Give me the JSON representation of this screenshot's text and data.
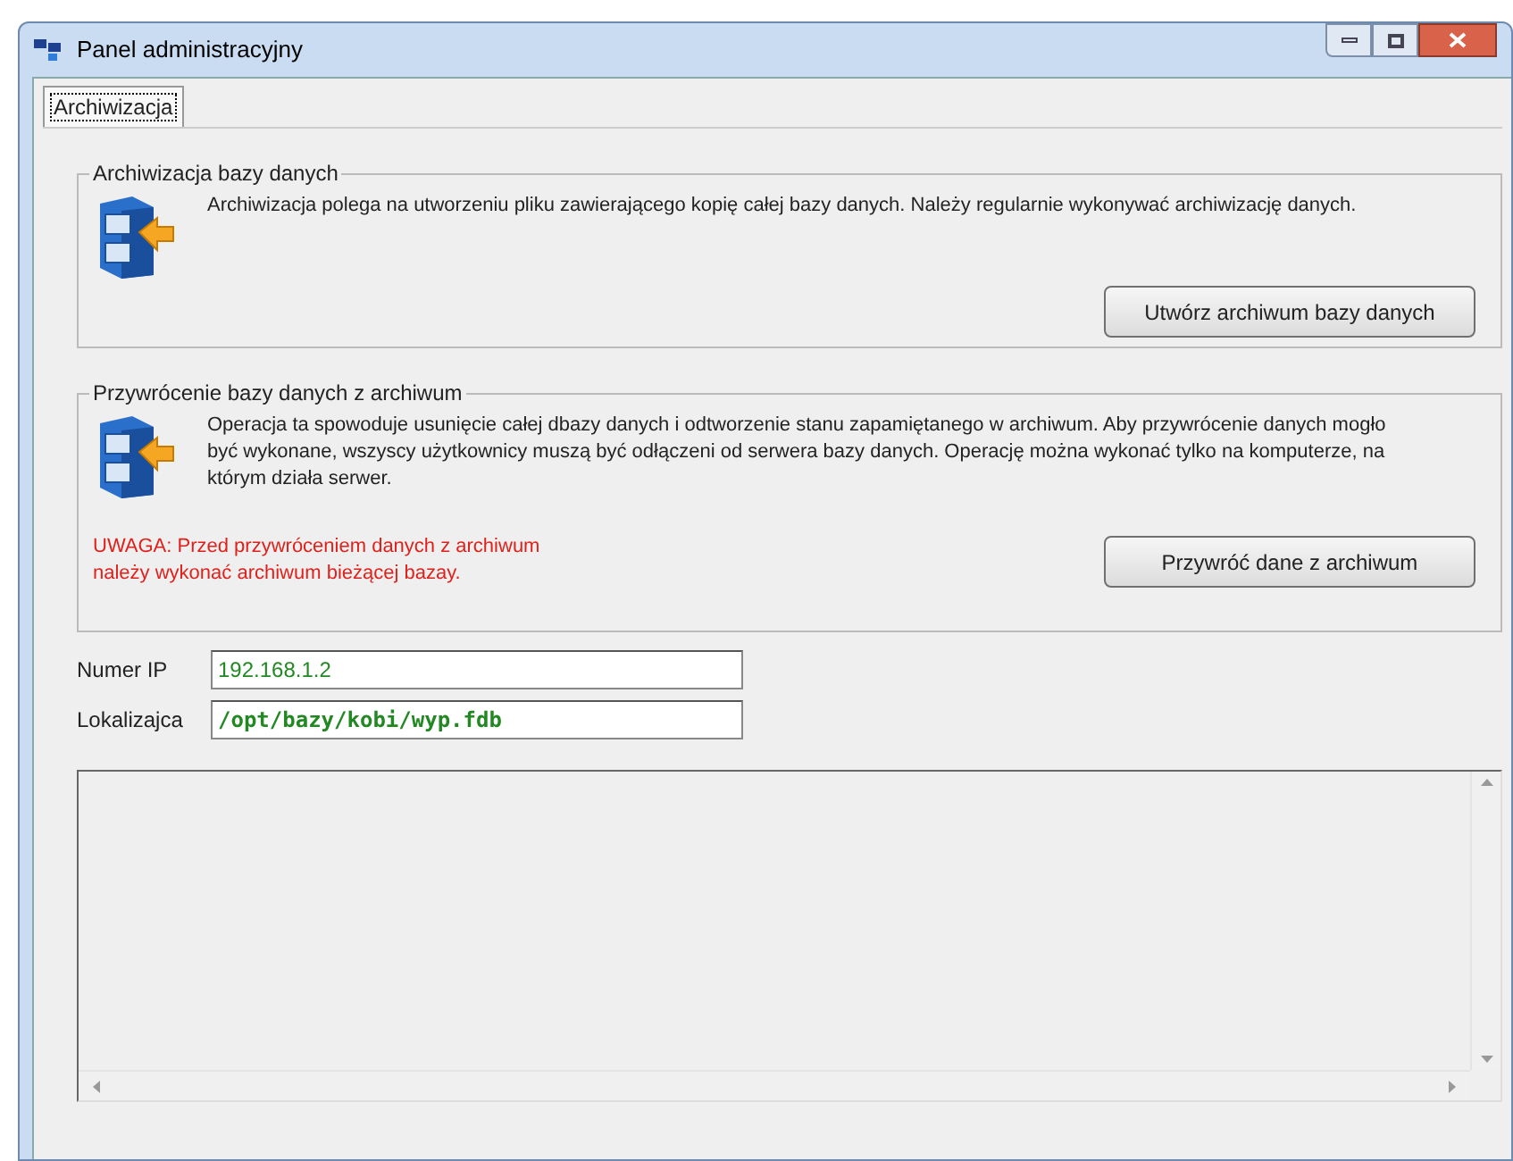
{
  "window": {
    "title": "Panel administracyjny"
  },
  "tabs": [
    {
      "label": "Archiwizacja",
      "selected": true
    }
  ],
  "groups": [
    {
      "title": "Archiwizacja bazy danych",
      "description": "Archiwizacja polega na utworzeniu pliku zawierającego kopię całej bazy danych. Należy regularnie wykonywać archiwizację danych.",
      "button": "Utwórz archiwum bazy danych"
    },
    {
      "title": "Przywrócenie bazy danych z archiwum",
      "description": "Operacja ta spowoduje usunięcie całej dbazy danych i odtworzenie stanu zapamiętanego w archiwum. Aby przywrócenie danych mogło być wykonane, wszyscy użytkownicy muszą być odłączeni od serwera bazy danych. Operację można wykonać tylko na komputerze, na którym działa serwer.",
      "warning": "UWAGA: Przed przywróceniem danych z archiwum należy wykonać archiwum bieżącej bazay.",
      "button": "Przywróć dane z archiwum"
    }
  ],
  "fields": [
    {
      "label": "Numer IP",
      "value": "192.168.1.2",
      "bold": false
    },
    {
      "label": "Lokalizajca",
      "value": "/opt/bazy/kobi/wyp.fdb",
      "bold": true
    }
  ]
}
